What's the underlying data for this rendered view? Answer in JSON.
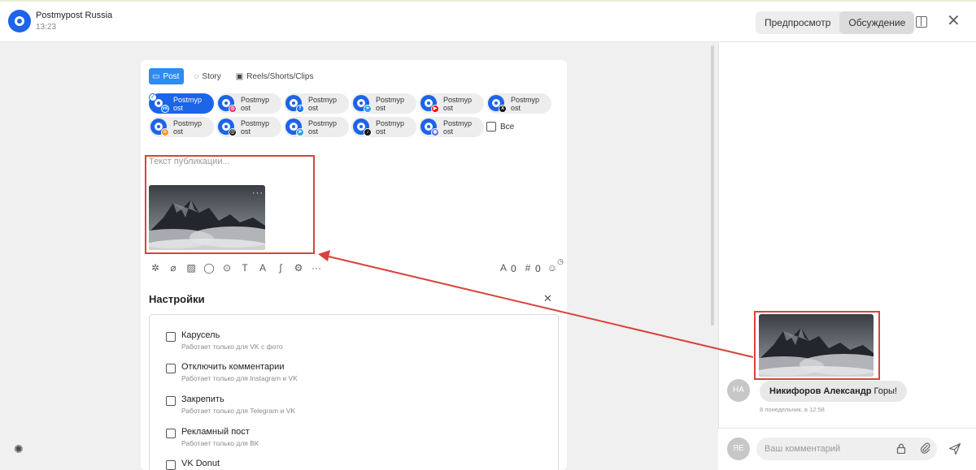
{
  "header": {
    "account_name": "Postmypost Russia",
    "time": "13:23",
    "toggle": {
      "preview_label": "Предпросмотр",
      "discussion_label": "Обсуждение",
      "active": "discussion"
    }
  },
  "composer": {
    "tabs": [
      {
        "label": "Post",
        "icon": "layout-icon",
        "active": true
      },
      {
        "label": "Story",
        "icon": "story-ring-icon",
        "active": false
      },
      {
        "label": "Reels/Shorts/Clips",
        "icon": "video-icon",
        "active": false
      }
    ],
    "accounts": [
      {
        "name": "Postmypost",
        "network": "vk",
        "selected": true,
        "color": "#0077ff",
        "glyph": "vk"
      },
      {
        "name": "Postmypost",
        "network": "instagram",
        "selected": false,
        "color": "#e1306c",
        "glyph": "◎"
      },
      {
        "name": "Postmypost",
        "network": "facebook",
        "selected": false,
        "color": "#1877f2",
        "glyph": "f"
      },
      {
        "name": "Postmypost",
        "network": "bluesky",
        "selected": false,
        "color": "#1da1f2",
        "glyph": "✦"
      },
      {
        "name": "Postmypost",
        "network": "youtube",
        "selected": false,
        "color": "#ff0000",
        "glyph": "▶"
      },
      {
        "name": "Postmypost",
        "network": "x",
        "selected": false,
        "color": "#111111",
        "glyph": "X"
      },
      {
        "name": "Postmypost",
        "network": "odnoklassniki",
        "selected": false,
        "color": "#f7931e",
        "glyph": "o"
      },
      {
        "name": "Postmypost",
        "network": "threads",
        "selected": false,
        "color": "#111111",
        "glyph": "@"
      },
      {
        "name": "Postmypost",
        "network": "telegram",
        "selected": false,
        "color": "#2aa3df",
        "glyph": "➤"
      },
      {
        "name": "Postmypost",
        "network": "tiktok",
        "selected": false,
        "color": "#111111",
        "glyph": "♪"
      },
      {
        "name": "Postmypost",
        "network": "discord",
        "selected": false,
        "color": "#5865f2",
        "glyph": "◉"
      }
    ],
    "account_name_line1": "Postmyp",
    "account_name_line2": "ost",
    "all_label": "Все",
    "text_placeholder": "Текст публикации...",
    "media_more": "···",
    "toolbar_icons": [
      "ai-sparkle-icon",
      "attach-icon",
      "image-icon",
      "speech-bubble-icon",
      "location-icon",
      "text-format-icon",
      "font-size-icon",
      "signature-icon",
      "gear-icon",
      "more-icon"
    ],
    "char_count": "0",
    "hashtag_count": "0"
  },
  "settings": {
    "title": "Настройки",
    "options": [
      {
        "label": "Карусель",
        "hint": "Работает только для VK с фото",
        "checked": false
      },
      {
        "label": "Отключить комментарии",
        "hint": "Работает только для Instagram и VK",
        "checked": false
      },
      {
        "label": "Закрепить",
        "hint": "Работает только для Telegram и VK",
        "checked": false
      },
      {
        "label": "Рекламный пост",
        "hint": "Работает только для ВК",
        "checked": false
      },
      {
        "label": "VK Donut",
        "hint": "",
        "checked": false
      }
    ]
  },
  "discussion": {
    "message": {
      "author_initials": "НА",
      "author": "Никифоров Александр",
      "text": "Горы!",
      "date": "8 понедельник, в 12:58"
    },
    "me_initials": "ЯЕ",
    "comment_placeholder": "Ваш комментарий"
  },
  "colors": {
    "accent": "#1c64e8",
    "tab_active": "#2d8cf0",
    "highlight": "#d9433b"
  }
}
